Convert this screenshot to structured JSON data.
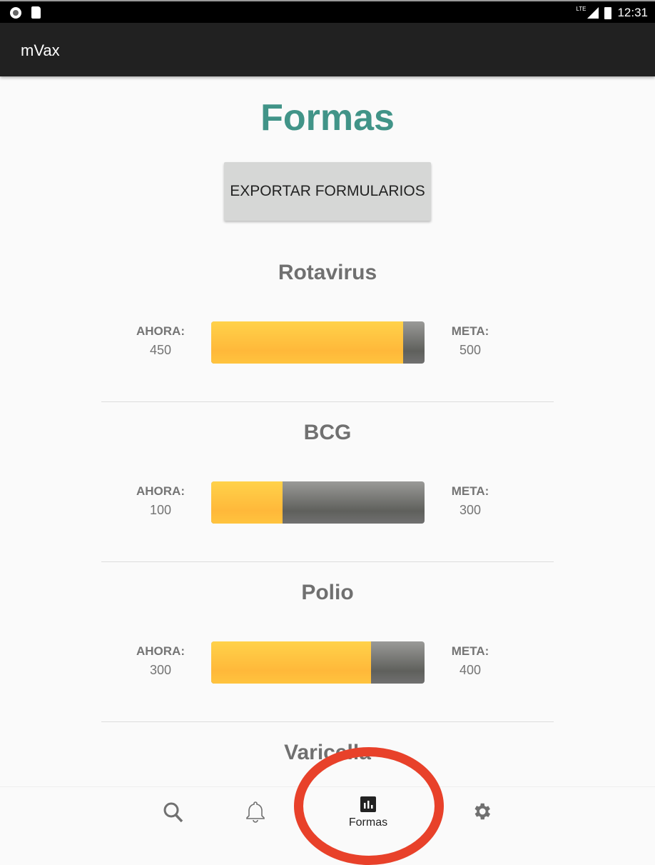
{
  "status_bar": {
    "time": "12:31",
    "network": "LTE"
  },
  "app_bar": {
    "title": "mVax"
  },
  "page": {
    "title": "Formas",
    "export_button": "EXPORTAR FORMULARIOS"
  },
  "labels": {
    "now": "AHORA:",
    "goal": "META:"
  },
  "colors": {
    "title": "#419488",
    "progress": "#ffc43e",
    "remaining": "#6a6b68",
    "annotation": "#e8412a"
  },
  "vaccines": [
    {
      "name": "Rotavirus",
      "now": "450",
      "goal": "500",
      "progress": 0.9
    },
    {
      "name": "BCG",
      "now": "100",
      "goal": "300",
      "progress": 0.333
    },
    {
      "name": "Polio",
      "now": "300",
      "goal": "400",
      "progress": 0.75
    },
    {
      "name": "Varicella"
    }
  ],
  "bottom_nav": {
    "items": [
      {
        "icon": "search-icon"
      },
      {
        "icon": "bell-icon"
      },
      {
        "icon": "bar-chart-icon",
        "label": "Formas",
        "active": true
      },
      {
        "icon": "gear-icon"
      }
    ]
  }
}
